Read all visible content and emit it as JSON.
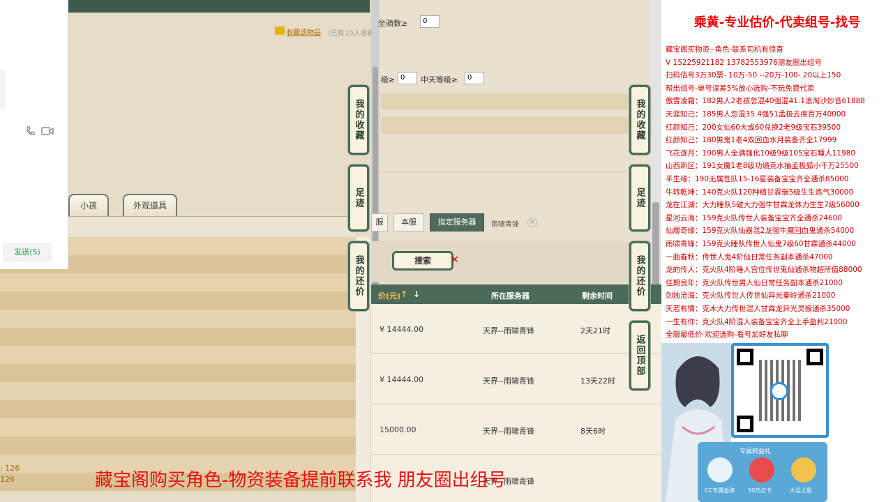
{
  "left": {
    "chat_send": "发送(S)",
    "favorite_link": "收藏该物品",
    "favorite_note": "(已有10人收藏",
    "tab_child": "小孩",
    "tab_appearance": "外观道具",
    "stat_1": ": 126",
    "stat_2": "126"
  },
  "side_buttons": {
    "favorites": "我的收藏",
    "footprint": "足迹",
    "bargain": "我的还价",
    "back_top": "返回顶部"
  },
  "mid": {
    "mount_label": "坐骑数≥",
    "mount_value": "0",
    "level_label": "级≥",
    "level_value": "0",
    "tian_label": "中天等级≥",
    "tian_value": "0",
    "server_tabs": [
      "服",
      "本服",
      "指定服务器"
    ],
    "server_tag": "雨啸青锋",
    "search_label": "搜索",
    "table_header": {
      "price": "价(元)",
      "server": "所在服务器",
      "remaining": "剩余时间"
    },
    "rows": [
      {
        "price": "¥ 14444.00",
        "server": "天界--雨啸青锋",
        "remaining": "2天21时"
      },
      {
        "price": "¥ 14444.00",
        "server": "天界--雨啸青锋",
        "remaining": "13天22时"
      },
      {
        "price": "15000.00",
        "server": "天界--雨啸青锋",
        "remaining": "8天6时"
      },
      {
        "price": "",
        "server": "天界--雨啸青锋",
        "remaining": ""
      }
    ]
  },
  "right": {
    "title": "乘黄-专业估价-代卖组号-找号",
    "lines": [
      "藏宝阁买物资--角色-联系司机有惊喜",
      "V 15225921182  13782553976朋友圈出组号",
      "扫码估号3万30票- 10万-50 --20万-100- 20以上150",
      "帮出组号-单号误差5%放心选购-不玩免费代卖",
      "傲雪凌霜：182男人2老孩忽混40强混41.1浪淘沙妙音61888",
      "天涯知己：185男人忽混35.4强51孟极去疾百万40000",
      "红颜知己：200女仙60大成60兑换2老9级宝石39500",
      "红颜知己：180男鬼1老4双回血水月装备齐全17999",
      "飞花逐月：190男人全满强化10级9级105宝石睡人11980",
      "山西新区：191女魔1老8级功绩克水抽孟极狐小千万25500",
      "半生缘：190无属性队15-16星装备宝宝齐全通杀85000",
      "牛转乾坤：140克火队120种植甘霖瑞5级生生炼气30000",
      "龙在江湖：大力睡队5破大力强牛甘霖龙体力生生7级56000",
      "星河云海：159克火队传世人装备宝宝齐全通杀24600",
      "仙履奇缘：159克火队仙器混2龙强牛魔回血鬼通杀54000",
      "雨啸青锋：159克火睡队传世人仙鬼7级60甘霖通杀44000",
      "一曲春秋：传世人鬼4阶仙日常任务副本通杀47000",
      "龙的传人：克火队4阶睡人宫位传世鬼仙通杀物超所值88000",
      "佳期良年：克火队传世男人仙日常任务副本通杀21000",
      "剑烛沧海：克火队传世人传世仙异光秦岭通杀21000",
      "天若有情：克木大力传世混人甘霖龙异光灵猴通杀35000",
      "一生有你：克火队4阶混人装备宝宝齐全上手盈利21000",
      "全服最低价-欢迎选购-看号加好友私聊"
    ],
    "promo_caption": "专属权益礼",
    "promo_items": [
      "CC专属坐骑",
      "50元点卡",
      "大话之星"
    ]
  },
  "banner": "藏宝阁购买角色-物资装备提前联系我     朋友圈出组号"
}
